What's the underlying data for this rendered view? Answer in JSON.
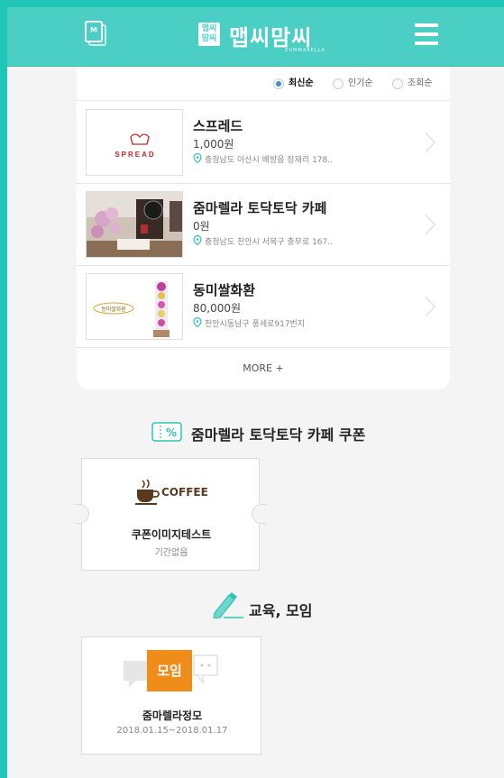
{
  "header": {
    "logo_box_text": "맵씨\n맘씨",
    "logo_text": "맵씨맘씨",
    "logo_sub": "ZUMMARELLA",
    "left_icon_letter": "M"
  },
  "sort": {
    "options": [
      {
        "label": "최신순",
        "selected": true
      },
      {
        "label": "인기순",
        "selected": false
      },
      {
        "label": "조회순",
        "selected": false
      }
    ]
  },
  "list": {
    "items": [
      {
        "title": "스프레드",
        "price": "1,000원",
        "address": "충청남도 아산시 배방읍 장재리 178..",
        "thumb_text": "SPREAD"
      },
      {
        "title": "줌마렐라 토닥토닥 카페",
        "price": "0원",
        "address": "충청남도 천안시 서북구 충무로 167..",
        "thumb_text": ""
      },
      {
        "title": "동미쌀화환",
        "price": "80,000원",
        "address": "천안시동남구 풍세로917번지",
        "thumb_text": "동미쌀화환"
      }
    ],
    "more_label": "MORE +"
  },
  "coupon_section": {
    "title": "줌마렐라 토닥토닥 카페 쿠폰",
    "icon_text": "%",
    "coupon": {
      "image_label": "COFFEE",
      "name": "쿠폰이미지테스트",
      "period": "기간없음"
    }
  },
  "meeting_section": {
    "title": "교육, 모임",
    "item": {
      "badge": "모임",
      "name": "줌마렐라정모",
      "date": "2018.01.15~2018.01.17"
    }
  },
  "colors": {
    "brand": "#4bcfc4",
    "outer": "#1fc5b6",
    "radio_on": "#3b8fd6",
    "badge": "#f08c1a",
    "pin": "#2ec3b5"
  }
}
